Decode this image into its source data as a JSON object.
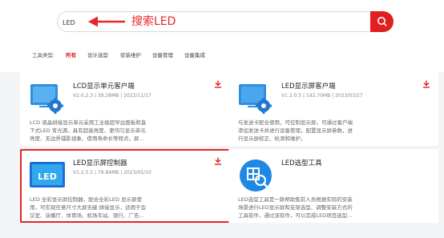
{
  "search": {
    "value": "LED"
  },
  "annotation": {
    "text": "搜索LED",
    "color": "#e8262a"
  },
  "filter": {
    "label": "工具类型:",
    "items": [
      "所有",
      "设计选型",
      "安装维护",
      "设备管理",
      "设备集成"
    ],
    "active_index": 0
  },
  "cards": [
    {
      "title": "LCD显示单元客户端",
      "meta": "V2.0.2.3  |  39.28MB  |  2022/11/17",
      "desc": [
        "LCD 液晶拼接显示单元采用工业级超窄边面板和直",
        "下式LED 背光源，具有超高亮度、更均匀显示单元",
        "亮度、无边界镭影视象、使用寿命长等特点。屏..."
      ],
      "icon": "lcd-app-icon"
    },
    {
      "title": "LED显示屏客户端",
      "meta": "V1.2.0.5  |  192.70MB  |  2023/03/27",
      "desc": [
        "与发送卡配合使用，可控制显示屏。可通过客户端",
        "添加发送卡并进行设备管理，配置显示屏参数，进",
        "行显示屏校正、检测和维护。"
      ],
      "icon": "led-client-app-icon"
    },
    {
      "title": "LED显示屏控制器",
      "meta": "V1.2.5.5  |  78.84MB  |  2023/05/10",
      "desc": [
        "LED 全彩显示屏控制器，配合全彩LED 显示屏使",
        "用，可实现任意尺寸大屏无缝 拼接显示，适用于会",
        "议室、演播厅、体育场、机场车站、银行、广告..."
      ],
      "icon": "led-controller-app-icon",
      "thumb_label": "LED"
    },
    {
      "title": "LED选型工具",
      "meta": "",
      "desc": [
        "LED选型工具是一款帮助售前人员根据实际的安装",
        "场景进行LED显示屏和支架选型、调整安装方式的",
        "工具软件，通过该软件，可以完成LED项目选型..."
      ],
      "icon": "led-selection-app-icon"
    }
  ],
  "colors": {
    "accent": "#e02020",
    "download": "#e02020",
    "app_blue": "#1e88e5"
  }
}
